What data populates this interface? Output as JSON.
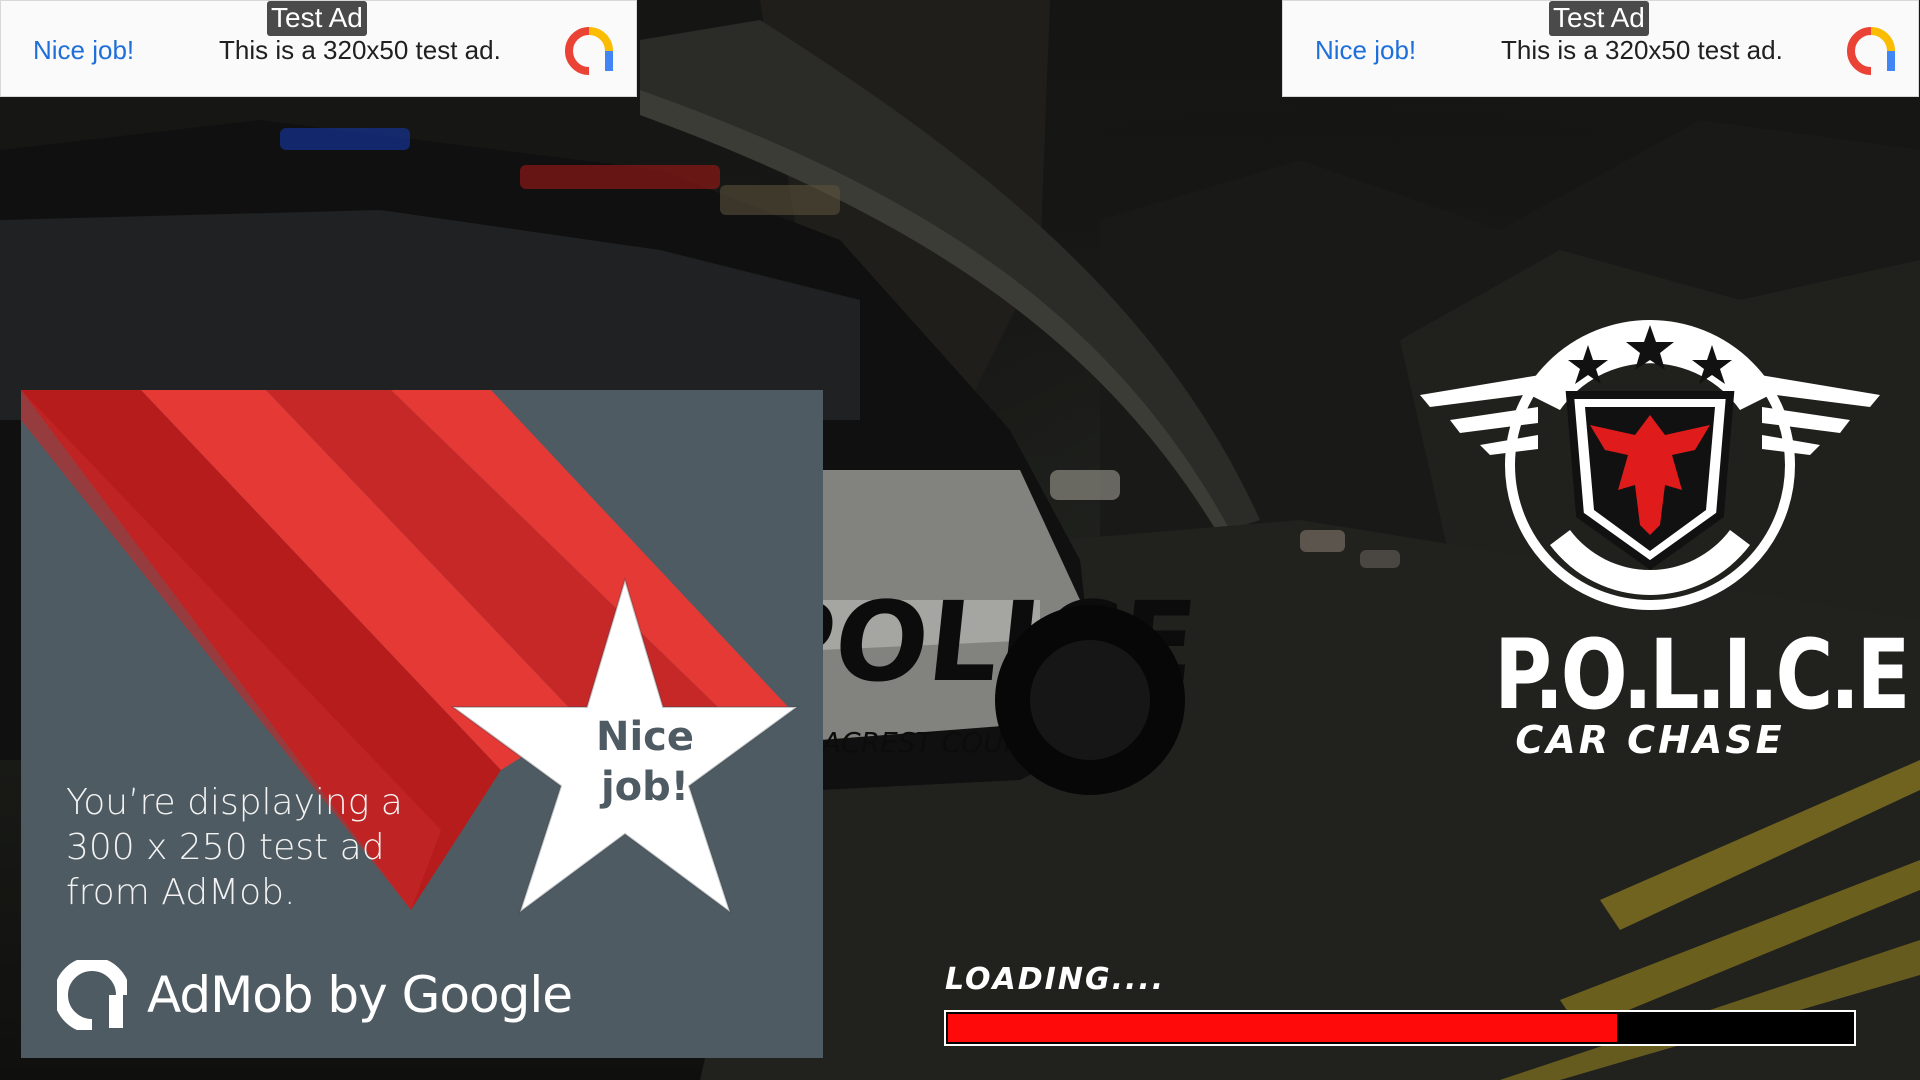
{
  "banners": [
    {
      "nice_label": "Nice job!",
      "description": "This is a 320x50 test ad.",
      "tag": "Test Ad",
      "logo_icon": "admob-logo-icon"
    },
    {
      "nice_label": "Nice job!",
      "description": "This is a 320x50 test ad.",
      "tag": "Test Ad",
      "logo_icon": "admob-logo-icon"
    }
  ],
  "interstitial": {
    "message": "You’re displaying a 300 x 250 test ad from AdMob.",
    "star_text": "Nice job!",
    "brand": "AdMob by Google",
    "background_color": "#4f5b62",
    "accent_color": "#e53935"
  },
  "game": {
    "logo_icon": "police-eagle-emblem-icon",
    "title": "P.O.L.I.C.E",
    "subtitle": "CAR CHASE"
  },
  "loading": {
    "label": "LOADING....",
    "progress": 0.74,
    "bar_color": "#ff0a0a"
  },
  "background_scene": "police car chase on mountain road",
  "decal_text": [
    "POLICE",
    "ACREST COUNTY"
  ]
}
